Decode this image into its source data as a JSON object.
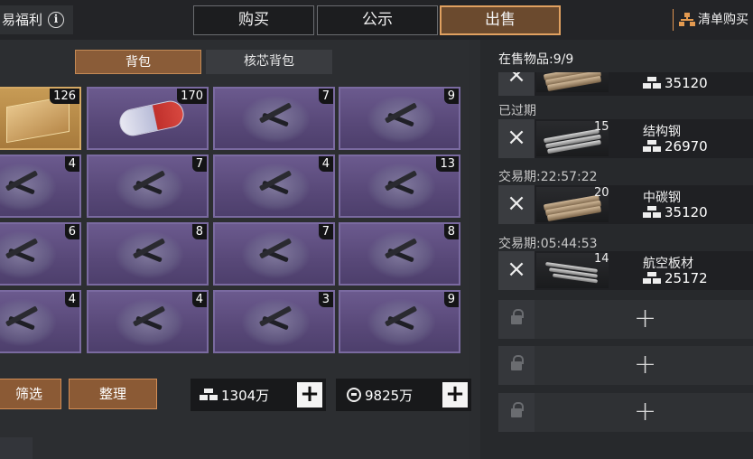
{
  "header": {
    "title": "易福利",
    "tabs": [
      {
        "label": "购买",
        "active": false
      },
      {
        "label": "公示",
        "active": false
      },
      {
        "label": "出售",
        "active": true
      }
    ],
    "list_button": "清单购买"
  },
  "inventory": {
    "subtabs": [
      {
        "label": "背包",
        "active": true
      },
      {
        "label": "核芯背包",
        "active": false
      }
    ],
    "cells": [
      {
        "count": "126",
        "kind": "gold-boxes"
      },
      {
        "count": "170",
        "kind": "pill"
      },
      {
        "count": "7",
        "kind": "crate"
      },
      {
        "count": "9",
        "kind": "crate"
      },
      {
        "count": "4",
        "kind": "crate"
      },
      {
        "count": "7",
        "kind": "crate"
      },
      {
        "count": "4",
        "kind": "crate"
      },
      {
        "count": "13",
        "kind": "crate"
      },
      {
        "count": "6",
        "kind": "crate"
      },
      {
        "count": "8",
        "kind": "crate"
      },
      {
        "count": "7",
        "kind": "crate"
      },
      {
        "count": "8",
        "kind": "crate"
      },
      {
        "count": "4",
        "kind": "crate"
      },
      {
        "count": "4",
        "kind": "crate"
      },
      {
        "count": "3",
        "kind": "crate"
      },
      {
        "count": "9",
        "kind": "crate"
      }
    ],
    "filter_label": "筛选",
    "sort_label": "整理",
    "currency_bars": "1304万",
    "currency_coins": "9825万",
    "plus_symbol": "+"
  },
  "sale_panel": {
    "on_sale_label": "在售物品:9/9",
    "close_symbol": "×",
    "rows": [
      {
        "status": "",
        "qty": "",
        "name": "",
        "price": "35120",
        "rods": "brown"
      },
      {
        "status": "已过期",
        "qty": "15",
        "name": "结构钢",
        "price": "26970",
        "rods": "steel"
      },
      {
        "status": "交易期:22:57:22",
        "qty": "20",
        "name": "中碳钢",
        "price": "35120",
        "rods": "brown"
      },
      {
        "status": "交易期:05:44:53",
        "qty": "14",
        "name": "航空板材",
        "price": "25172",
        "rods": "plate"
      }
    ],
    "locked_slots": 3
  },
  "colors": {
    "accent": "#e0a060",
    "cell_purple": "#584878",
    "button_brown": "#8b5a35"
  }
}
